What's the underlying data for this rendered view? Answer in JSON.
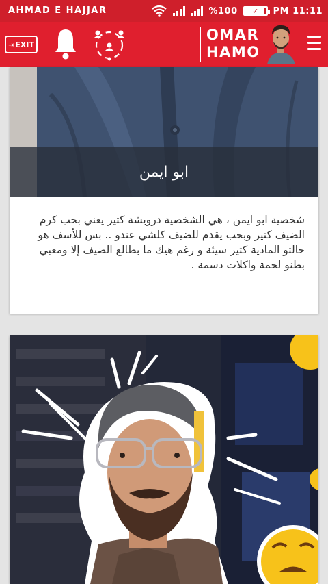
{
  "status_bar": {
    "carrier": "AHMAD E HAJJAR",
    "battery_level": "%100",
    "time": "PM 11:11"
  },
  "app_bar": {
    "exit_label": "EXIT",
    "brand_line1": "OMAR",
    "brand_line2": "HAMO",
    "accent_color": "#e01f2e"
  },
  "feed": {
    "cards": [
      {
        "caption": "ابو ايمن",
        "body": "شخصية ابو ايمن ، هي الشخصية درويشة كتير يعني بحب كرم الضيف كتير وبحب يقدم للضيف كلشي عندو .. بس للأسف هو حالتو المادية كتير سيئة و رغم هيك ما بطالع الضيف إلا ومعبي بطنو لحمة واكلات دسمة ."
      },
      {
        "caption": ""
      }
    ]
  },
  "icons": {
    "exit": "exit-icon",
    "notifications": "bell-icon",
    "characters": "users-circle-icon",
    "menu": "hamburger-icon",
    "wifi": "wifi-icon",
    "signal": "signal-icon",
    "battery": "battery-icon"
  }
}
